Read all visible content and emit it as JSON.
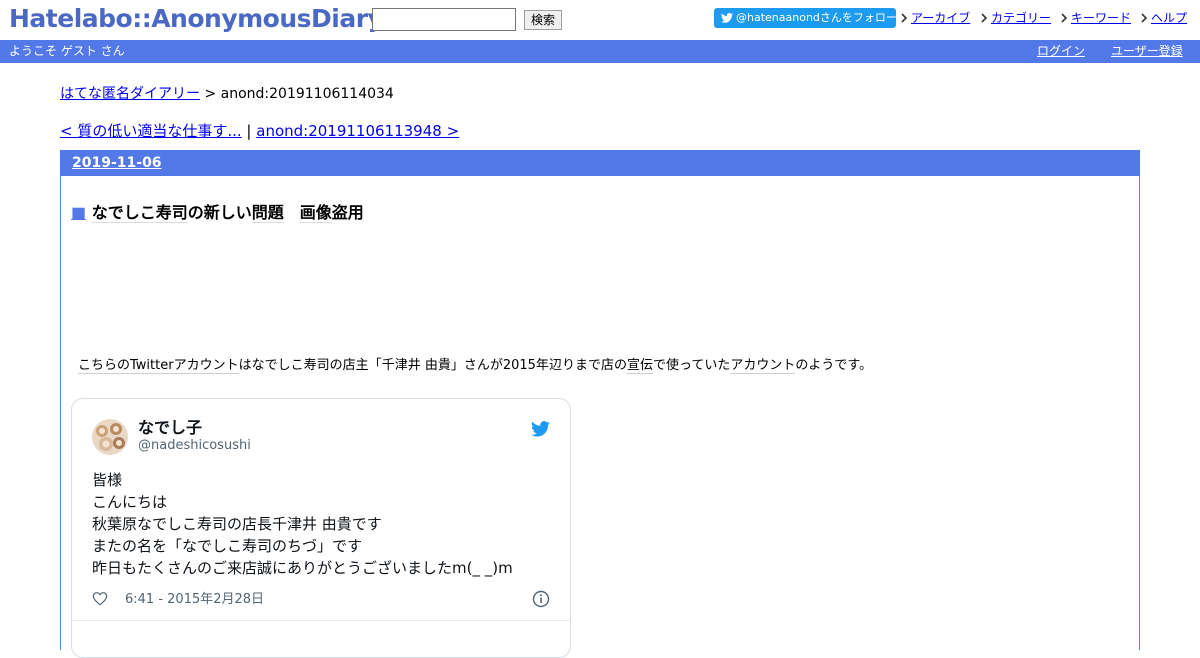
{
  "header": {
    "logo_text": "Hatelabo::AnonymousDiary",
    "search": {
      "value": "",
      "placeholder": ""
    },
    "search_button_label": "検索",
    "follow_button_label": "@hatenaanondさんをフォロー",
    "links": [
      {
        "label": "アーカイブ"
      },
      {
        "label": "カテゴリー"
      },
      {
        "label": "キーワード"
      },
      {
        "label": "ヘルプ"
      }
    ]
  },
  "welcome_bar": {
    "welcome_text": "ようこそ ゲスト さん",
    "login_label": "ログイン",
    "register_label": "ユーザー登録"
  },
  "breadcrumb": {
    "root_label": "はてな匿名ダイアリー",
    "separator": " > ",
    "current": "anond:20191106114034"
  },
  "prevnext": {
    "prev_label": "< 質の低い適当な仕事す...",
    "separator": " | ",
    "next_label": "anond:20191106113948 >"
  },
  "day": {
    "date": "2019-11-06"
  },
  "entry": {
    "title_marker": "■",
    "title_part1": "なでしこ寿司",
    "title_part2": "の新しい",
    "title_part3": "問題",
    "title_part4": "　",
    "title_part5": "画像",
    "title_part6": "盗用",
    "text_segments": [
      {
        "t": "こちらの",
        "kw": true
      },
      {
        "t": "Twitter",
        "kw": true
      },
      {
        "t": "アカウント",
        "kw": true
      },
      {
        "t": "は",
        "kw": false
      },
      {
        "t": "なでしこ寿司",
        "kw": false
      },
      {
        "t": "の",
        "kw": false
      },
      {
        "t": "店主",
        "kw": false
      },
      {
        "t": "「",
        "kw": false
      },
      {
        "t": "千津井 由貴",
        "kw": false
      },
      {
        "t": "」さんが",
        "kw": false
      },
      {
        "t": "2015年",
        "kw": false
      },
      {
        "t": "辺りまで",
        "kw": false
      },
      {
        "t": "店",
        "kw": false
      },
      {
        "t": "の",
        "kw": false
      },
      {
        "t": "宣伝",
        "kw": true
      },
      {
        "t": "で使っていた",
        "kw": false
      },
      {
        "t": "アカウント",
        "kw": true
      },
      {
        "t": "のようです。",
        "kw": false
      }
    ]
  },
  "tweet": {
    "name": "なでし子",
    "handle": "@nadeshicosushi",
    "lines": [
      "皆様",
      "こんにちは",
      "秋葉原なでしこ寿司の店長千津井 由貴です",
      "またの名を「なでしこ寿司のちづ」です",
      "昨日もたくさんのご来店誠にありがとうございましたm(_ _)m"
    ],
    "timestamp": "6:41 - 2015年2月28日"
  },
  "colors": {
    "accent": "#5279e7",
    "logo": "#4a69c5",
    "twitter_blue": "#1d9bf0",
    "link": "#0000ee"
  }
}
